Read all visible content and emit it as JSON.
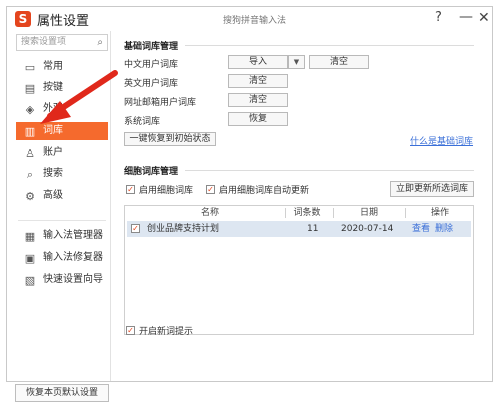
{
  "titlebar": {
    "title": "属性设置",
    "logo": "S",
    "subtitle": "搜狗拼音输入法",
    "help": "?",
    "minimize": "—",
    "close": "✕"
  },
  "sidebar": {
    "search_placeholder": "搜索设置项",
    "items": [
      {
        "icon": "monitor-icon",
        "glyph": "▭",
        "label": "常用"
      },
      {
        "icon": "keyboard-icon",
        "glyph": "▤",
        "label": "按键"
      },
      {
        "icon": "shirt-icon",
        "glyph": "◈",
        "label": "外观"
      },
      {
        "icon": "book-icon",
        "glyph": "▥",
        "label": "词库"
      },
      {
        "icon": "user-icon",
        "glyph": "♙",
        "label": "账户"
      },
      {
        "icon": "search-icon",
        "glyph": "⌕",
        "label": "搜索"
      },
      {
        "icon": "gear-icon",
        "glyph": "⚙",
        "label": "高级"
      }
    ],
    "tools": [
      {
        "icon": "manager-icon",
        "glyph": "▦",
        "label": "输入法管理器"
      },
      {
        "icon": "repair-icon",
        "glyph": "▣",
        "label": "输入法修复器"
      },
      {
        "icon": "wizard-icon",
        "glyph": "▧",
        "label": "快速设置向导"
      }
    ],
    "reset_label": "恢复本页默认设置",
    "active_index": 3
  },
  "basic": {
    "title": "基础词库管理",
    "rows": [
      {
        "label": "中文用户词库",
        "btn1": "导入",
        "btn2": "清空"
      },
      {
        "label": "英文用户词库",
        "btn1": "清空"
      },
      {
        "label": "网址邮箱用户词库",
        "btn1": "清空"
      },
      {
        "label": "系统词库",
        "btn1": "恢复"
      }
    ],
    "restore_btn": "一键恢复到初始状态",
    "what_link": "什么是基础词库"
  },
  "cell": {
    "title": "细胞词库管理",
    "cb1_label": "启用细胞词库",
    "cb2_label": "启用细胞词库自动更新",
    "update_btn": "立即更新所选词库",
    "columns": [
      "名称",
      "词条数",
      "日期",
      "操作"
    ],
    "rows": [
      {
        "checked": true,
        "name": "创业品牌支持计划",
        "count": "11",
        "date": "2020-07-14",
        "view": "查看",
        "delete": "删除"
      }
    ]
  },
  "footer": {
    "new_word_tip": "开启新词提示"
  },
  "colors": {
    "accent": "#f56a2d",
    "arrow": "#e0281b",
    "link": "#3a6fd8"
  }
}
